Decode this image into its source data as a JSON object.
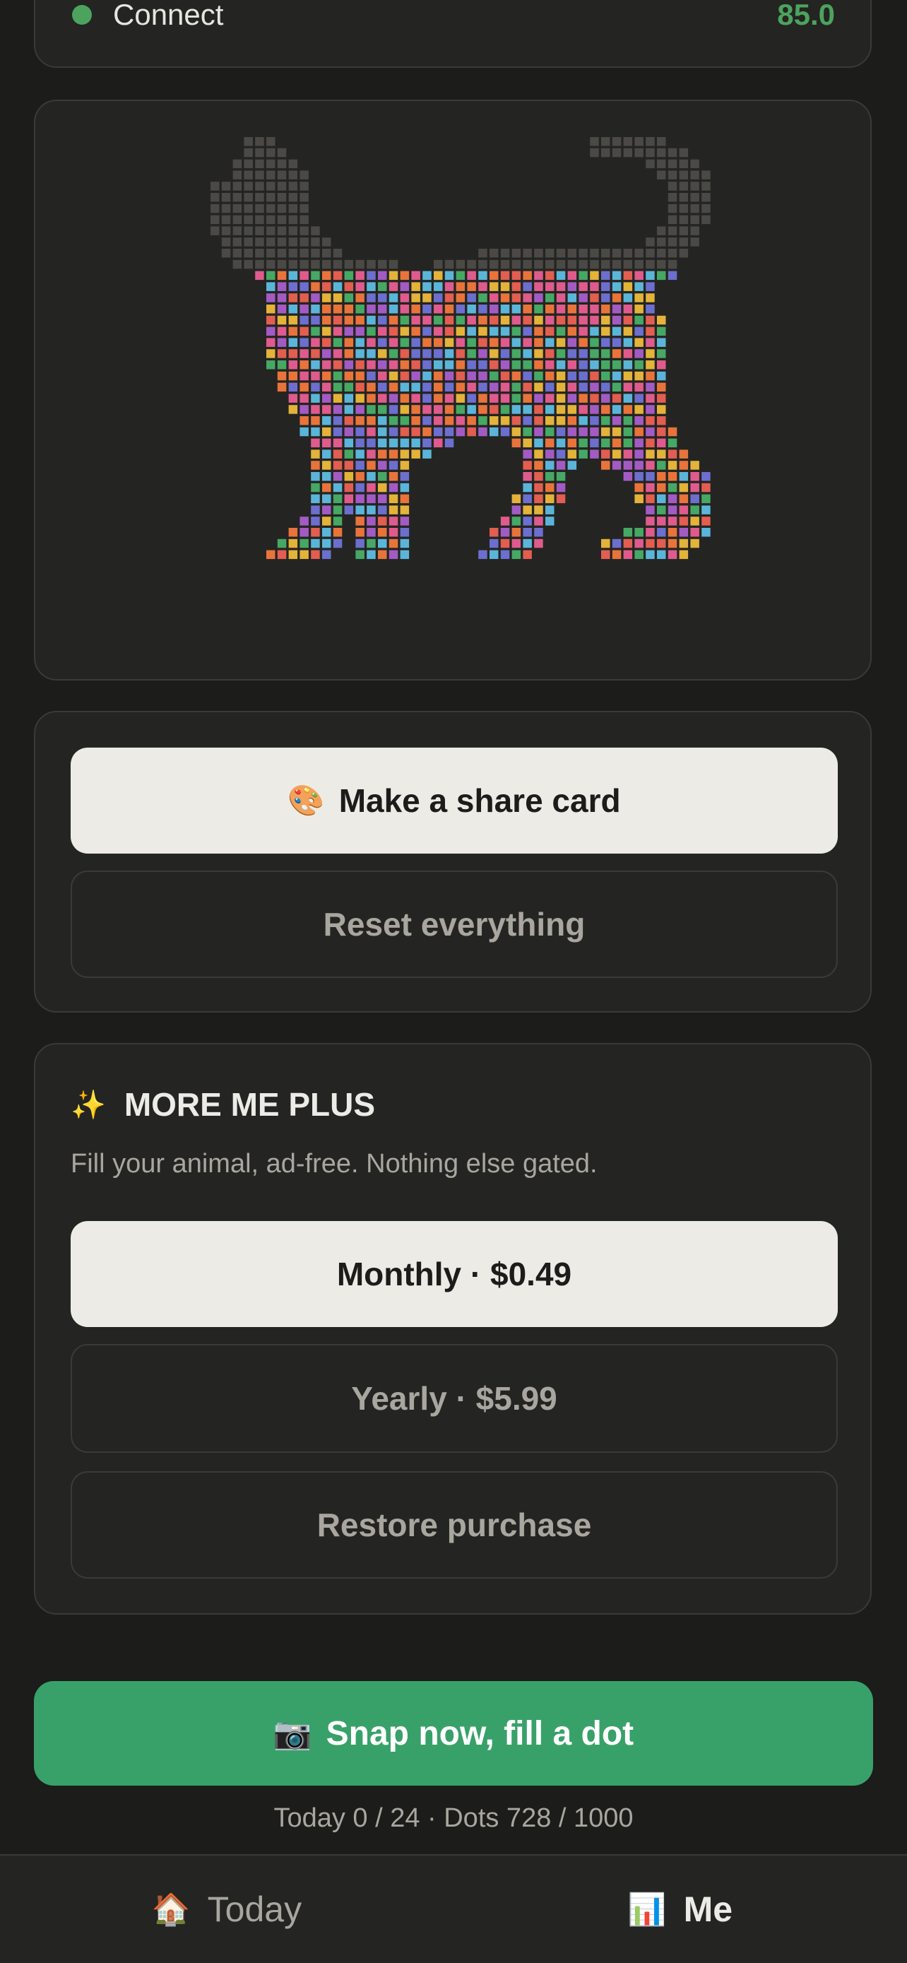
{
  "top_row": {
    "label": "Connect",
    "value": "85.0"
  },
  "actions": {
    "share_emoji": "🎨",
    "share_label": "Make a share card",
    "reset_label": "Reset everything"
  },
  "plus": {
    "emoji": "✨",
    "title": "MORE ME PLUS",
    "subtitle": "Fill your animal, ad-free. Nothing else gated.",
    "monthly_label": "Monthly · $0.49",
    "yearly_label": "Yearly · $5.99",
    "restore_label": "Restore purchase"
  },
  "snap": {
    "emoji": "📷",
    "label": "Snap now, fill a dot"
  },
  "stats": "Today 0 / 24 · Dots 728 / 1000",
  "tabs": [
    {
      "emoji": "🏠",
      "label": "Today"
    },
    {
      "emoji": "📊",
      "label": "Me"
    }
  ],
  "colors": {
    "accent_green": "#38a169",
    "status_green": "#4ca35e",
    "card_bg": "#242422",
    "page_bg": "#1c1c1a",
    "empty_dot": "#4a4946",
    "dot_palette": [
      "#e8743b",
      "#5bb5d9",
      "#6c6fce",
      "#df5b8d",
      "#46a864",
      "#e3b33a",
      "#a35bc4",
      "#e25e50"
    ]
  },
  "progress": {
    "filled": 728,
    "total": 1000
  }
}
